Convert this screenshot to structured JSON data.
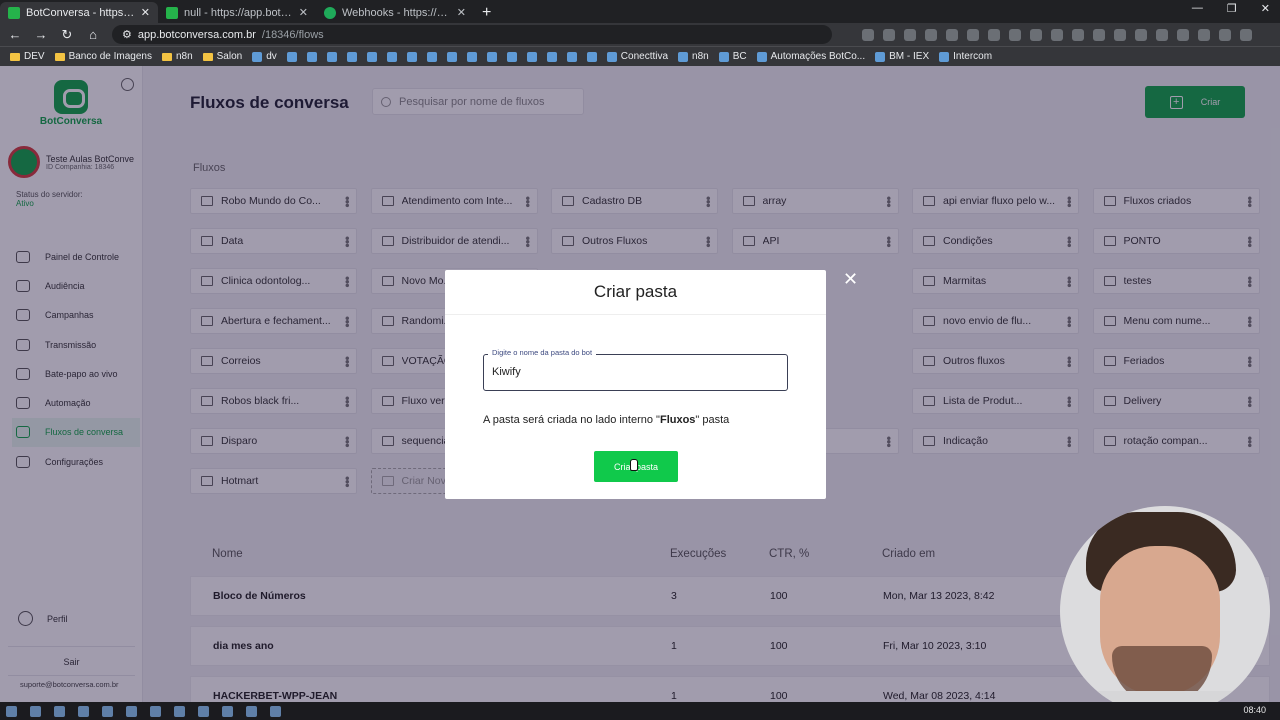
{
  "browser": {
    "tabs": [
      {
        "title": "BotConversa - https://app.botco...",
        "active": true
      },
      {
        "title": "null - https://app.botconversa.co...",
        "active": false
      },
      {
        "title": "Webhooks - https://dashboard.ki...",
        "active": false
      }
    ],
    "url_host": "app.botconversa.com.br",
    "url_path": "/18346/flows",
    "bookmarks": [
      "DEV",
      "Banco de Imagens",
      "n8n",
      "Salon",
      "dv",
      "Conecttiva",
      "n8n",
      "BC",
      "Automações BotCo...",
      "BM - IEX",
      "Intercom"
    ]
  },
  "sidebar": {
    "logo_text": "BotConversa",
    "account_name": "Teste Aulas BotConve",
    "company_id": "ID Companhia: 18346",
    "server_status_label": "Status do servidor:",
    "server_status_value": "Ativo",
    "items": [
      {
        "label": "Painel de Controle",
        "icon": "dashboard-icon"
      },
      {
        "label": "Audiência",
        "icon": "users-icon"
      },
      {
        "label": "Campanhas",
        "icon": "megaphone-icon"
      },
      {
        "label": "Transmissão",
        "icon": "send-icon"
      },
      {
        "label": "Bate-papo ao vivo",
        "icon": "chat-icon"
      },
      {
        "label": "Automação",
        "icon": "automation-icon"
      },
      {
        "label": "Fluxos de conversa",
        "icon": "flows-icon",
        "active": true
      },
      {
        "label": "Configurações",
        "icon": "gear-icon"
      }
    ],
    "profile_label": "Perfil",
    "logout_label": "Sair",
    "support_email": "suporte@botconversa.com.br"
  },
  "main": {
    "title": "Fluxos de conversa",
    "search_placeholder": "Pesquisar por nome de fluxos",
    "create_label": "Criar",
    "folders_label": "Fluxos",
    "folders": [
      "Robo Mundo do Co...",
      "Atendimento com Inte...",
      "Cadastro DB",
      "array",
      "api enviar fluxo pelo w...",
      "Fluxos criados",
      "Data",
      "Distribuidor de atendi...",
      "Outros Fluxos",
      "API",
      "Condições",
      "PONTO",
      "Clinica odontolog...",
      "Novo Mo...",
      "",
      "",
      "Marmitas",
      "testes",
      "Abertura e fechament...",
      "Randomi...",
      "",
      "",
      "novo envio de flu...",
      "Menu com nume...",
      "Correios",
      "VOTAÇÃO",
      "",
      "",
      "Outros fluxos",
      "Feriados",
      "Robos black fri...",
      "Fluxo veri...",
      "",
      "",
      "Lista de Produt...",
      "Delivery",
      "Disparo",
      "sequencia",
      "",
      "...",
      "Indicação",
      "rotação compan...",
      "Hotmart"
    ],
    "new_folder_label": "Criar Nov...",
    "table": {
      "headers": [
        "Nome",
        "Execuções",
        "CTR, %",
        "Criado em"
      ],
      "rows": [
        [
          "Bloco de Números",
          "3",
          "100",
          "Mon, Mar 13 2023, 8:42"
        ],
        [
          "dia mes ano",
          "1",
          "100",
          "Fri, Mar 10 2023, 3:10"
        ],
        [
          "HACKERBET-WPP-JEAN",
          "1",
          "100",
          "Wed, Mar 08 2023, 4:14"
        ]
      ]
    }
  },
  "modal": {
    "title": "Criar pasta",
    "field_label": "Digite o nome da pasta do bot",
    "field_value": "Kiwify",
    "note_prefix": "A pasta será criada no lado interno \"",
    "note_bold": "Fluxos",
    "note_suffix": "\" pasta",
    "button_label": "Criar pasta"
  },
  "taskbar": {
    "clock": "08:40"
  },
  "colors": {
    "brand_green": "#0fa547",
    "button_green": "#10c94b",
    "overlay": "#1e143c"
  }
}
